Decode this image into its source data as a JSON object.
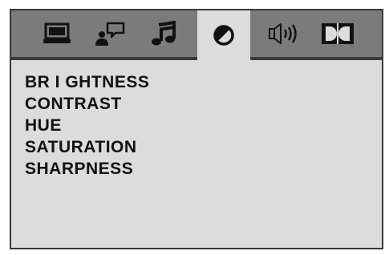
{
  "tabs": [
    {
      "icon": "monitor-icon",
      "active": false
    },
    {
      "icon": "speaker-person-icon",
      "active": false
    },
    {
      "icon": "music-note-icon",
      "active": false
    },
    {
      "icon": "video-settings-icon",
      "active": true
    },
    {
      "icon": "audio-speaker-icon",
      "active": false
    },
    {
      "icon": "dolby-icon",
      "active": false
    }
  ],
  "menu": {
    "items": [
      "BR I GHTNESS",
      "CONTRAST",
      "HUE",
      "SATURATION",
      "SHARPNESS"
    ]
  },
  "colors": {
    "tabbar": "#7b7b7b",
    "panel": "#dcdcdc",
    "icon": "#111111"
  }
}
